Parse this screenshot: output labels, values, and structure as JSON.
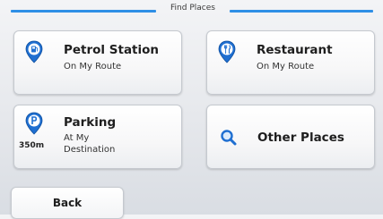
{
  "header": {
    "title": "Find Places"
  },
  "tiles": [
    {
      "title": "Petrol Station",
      "subtitle": "On My Route",
      "icon": "fuel-pin-icon"
    },
    {
      "title": "Restaurant",
      "subtitle": "On My Route",
      "icon": "restaurant-pin-icon"
    },
    {
      "title": "Parking",
      "subtitle_line1": "At My",
      "subtitle_line2": "Destination",
      "distance": "350m",
      "icon": "parking-pin-icon"
    },
    {
      "title": "Other Places",
      "icon": "search-icon"
    }
  ],
  "back_label": "Back",
  "colors": {
    "accent": "#2f8fe6",
    "pin": "#1f6fd1"
  }
}
